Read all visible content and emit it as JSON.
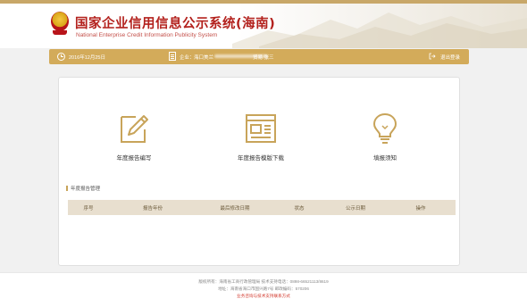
{
  "header": {
    "title": "国家企业信用信息公示系统(海南)",
    "subtitle": "National Enterprise Credit Information Publicity System",
    "brand_color": "#b3211d"
  },
  "infobar": {
    "date": "2016年12月25日",
    "company_label": "企业：",
    "company_name": "海口美兰",
    "company_tail": "贸易  张三",
    "exit_label": "退出登录",
    "bar_color": "#d3ab5a"
  },
  "tiles": [
    {
      "label": "年度报告编写",
      "icon": "edit-icon"
    },
    {
      "label": "年度报告模版下载",
      "icon": "template-download-icon"
    },
    {
      "label": "填报须知",
      "icon": "lightbulb-icon"
    }
  ],
  "section": {
    "title": "年度报告管理"
  },
  "table": {
    "columns": [
      "序号",
      "报告年份",
      "最后修改日期",
      "状态",
      "公示日期",
      "操作"
    ]
  },
  "footer": {
    "line1": "版权所有：海南省工商行政管理局  技术支持电话：0898-66521113/8619",
    "line2": "地址：海南省海口市国兴路7号  邮政编码：570206",
    "line3": "业务咨询与技术支持联系方式"
  }
}
